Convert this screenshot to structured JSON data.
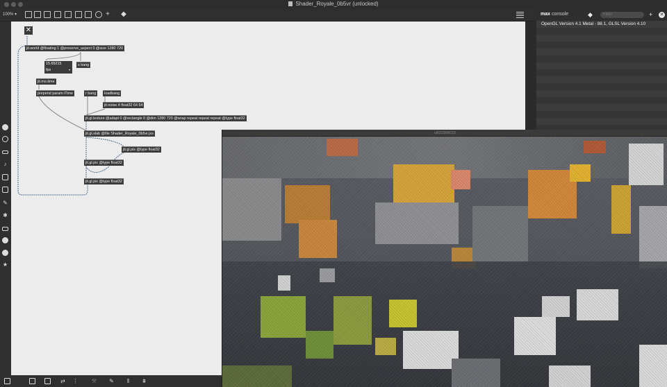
{
  "window": {
    "title": "Shader_Royale_0b5vr (unlocked)"
  },
  "toolbar": {
    "zoom": "100%",
    "zoom_caret": "▾"
  },
  "patcher": {
    "close_glyph": "✕",
    "objects": {
      "jit_world": "jit.world @floating 1 @preserve_aspect 0 @size 1280 720",
      "s_bang": "s bang",
      "jit_mo_time": "jit.mo.time",
      "prepend": "prepend param iTime",
      "r_bang": "r bang",
      "loadbang": "loadbang",
      "jit_noise": "jit.noise 4 float32 64 64",
      "jit_gl_texture": "jit.gl.texture @adapt 0 @rectangle 0 @dim 1280 720 @wrap repeat repeat repeat @type float32",
      "jit_gl_slab": "jit.gl.slab @file Shader_Royale_0b5vr.jxs",
      "jit_gl_pix_1": "jit.gl.pix @type float32",
      "jit_gl_pix_2": "jit.gl.pix @type float32",
      "jit_gl_pix_3": "jit.gl.pix @type float32"
    },
    "fps_box": {
      "value": "15.65215",
      "unit": "fps",
      "caret": "▾"
    }
  },
  "console": {
    "max_label": "max",
    "title": "console",
    "filter_placeholder": "Filter",
    "add_glyph": "+",
    "clear_glyph": "✕",
    "lines": [
      "OpenGL Version 4.1 Metal - 88.1, GLSL Version 4.10"
    ]
  },
  "render_window": {
    "title": "u821009010"
  },
  "colors": {
    "canvas": "#ececec",
    "object_bg": "#3b3b3b",
    "cord": "#4a6890",
    "console_bg": "#393939"
  }
}
